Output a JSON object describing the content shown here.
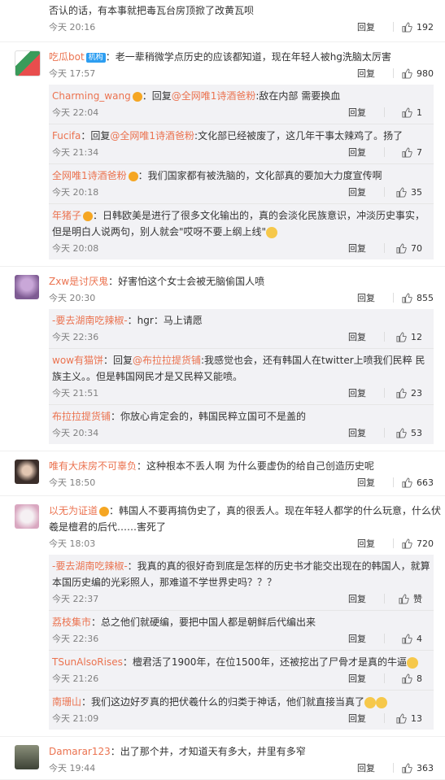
{
  "top": {
    "text": "否认的话，有本事就把毒瓦台房顶掀了改黄瓦呗",
    "time": "今天 20:16",
    "reply": "回复",
    "likes": "192"
  },
  "comments": [
    {
      "name": "吃瓜bot",
      "tag": "机构",
      "text": "：老一辈稍微学点历史的应该都知道，现在年轻人被hg洗脑太厉害",
      "time": "今天 17:57",
      "reply": "回复",
      "likes": "980",
      "subs": [
        {
          "name": "Charming_wang",
          "prefix": "：回复",
          "link": "@全网唯1诗酒爸粉",
          "text": ":敌在内部 需要换血",
          "time": "今天 22:04",
          "reply": "回复",
          "likes": "1"
        },
        {
          "name": "Fucifa",
          "prefix": "：回复",
          "link": "@全网唯1诗酒爸粉",
          "text": ":文化部已经被废了，这几年干事太辣鸡了。扬了",
          "time": "今天 21:34",
          "reply": "回复",
          "likes": "7"
        },
        {
          "name": "全网唯1诗酒爸粉",
          "prefix": "",
          "link": "",
          "text": "：我们国家都有被洗脑的，文化部真的要加大力度宣传啊",
          "time": "今天 20:18",
          "reply": "回复",
          "likes": "35"
        },
        {
          "name": "年猪子",
          "prefix": "",
          "link": "",
          "text": "：日韩欧美是进行了很多文化输出的，真的会淡化民族意识，冲淡历史事实，但是明白人说两句，别人就会\"哎呀不要上纲上线\"",
          "time": "今天 20:08",
          "reply": "回复",
          "likes": "70"
        }
      ]
    },
    {
      "name": "Zxw是讨厌鬼",
      "text": "：好害怕这个女士会被无脑偷国人喷",
      "time": "今天 20:30",
      "reply": "回复",
      "likes": "855",
      "subs": [
        {
          "name": "-要去湖南吃辣椒-",
          "prefix": "",
          "link": "",
          "text": "：hgr：马上请愿",
          "time": "今天 22:36",
          "reply": "回复",
          "likes": "12"
        },
        {
          "name": "wow有猫饼",
          "prefix": "：回复",
          "link": "@布拉拉提货铺",
          "text": ":我感觉也会，还有韩国人在twitter上喷我们民粹 民族主义。。但是韩国网民才是又民粹又能喷。",
          "time": "今天 21:51",
          "reply": "回复",
          "likes": "23"
        },
        {
          "name": "布拉拉提货铺",
          "prefix": "",
          "link": "",
          "text": "：你放心肯定会的，韩国民粹立国可不是盖的",
          "time": "今天 20:34",
          "reply": "回复",
          "likes": "53"
        }
      ]
    },
    {
      "name": "唯有大床房不可辜负",
      "text": "：这种根本不丢人啊 为什么要虚伪的给自己创造历史呢",
      "time": "今天 18:50",
      "reply": "回复",
      "likes": "663",
      "subs": []
    },
    {
      "name": "以无为证道",
      "text": "：韩国人不要再搞伪史了，真的很丢人。现在年轻人都学的什么玩意，什么伏羲是檀君的后代……害死了",
      "time": "今天 18:03",
      "reply": "回复",
      "likes": "720",
      "subs": [
        {
          "name": "-要去湖南吃辣椒-",
          "prefix": "",
          "link": "",
          "text": "：我真的真的很好奇到底是怎样的历史书才能交出现在的韩国人，就算本国历史编的光彩照人，那难道不学世界史吗？？？",
          "time": "今天 22:37",
          "reply": "回复",
          "likes": "赞"
        },
        {
          "name": "荔枝集市",
          "prefix": "",
          "link": "",
          "text": "：总之他们就硬编，要把中国人都是朝鲜后代编出来",
          "time": "今天 22:36",
          "reply": "回复",
          "likes": "4"
        },
        {
          "name": "TSunAlsoRises",
          "prefix": "",
          "link": "",
          "text": "：檀君活了1900年，在位1500年，还被挖出了尸骨才是真的牛逼",
          "time": "今天 21:26",
          "reply": "回复",
          "likes": "8"
        },
        {
          "name": "南珊山",
          "prefix": "",
          "link": "",
          "text": "：我们这边好歹真的把伏羲什么的归类于神话，他们就直接当真了",
          "time": "今天 21:09",
          "reply": "回复",
          "likes": "13"
        }
      ]
    },
    {
      "name": "Damarar123",
      "text": "：出了那个井，才知道天有多大，井里有多窄",
      "time": "今天 19:44",
      "reply": "回复",
      "likes": "363",
      "subs": []
    }
  ],
  "colors": {
    "name": "#eb7350",
    "meta": "#808080",
    "subBg": "#f2f2f5"
  }
}
